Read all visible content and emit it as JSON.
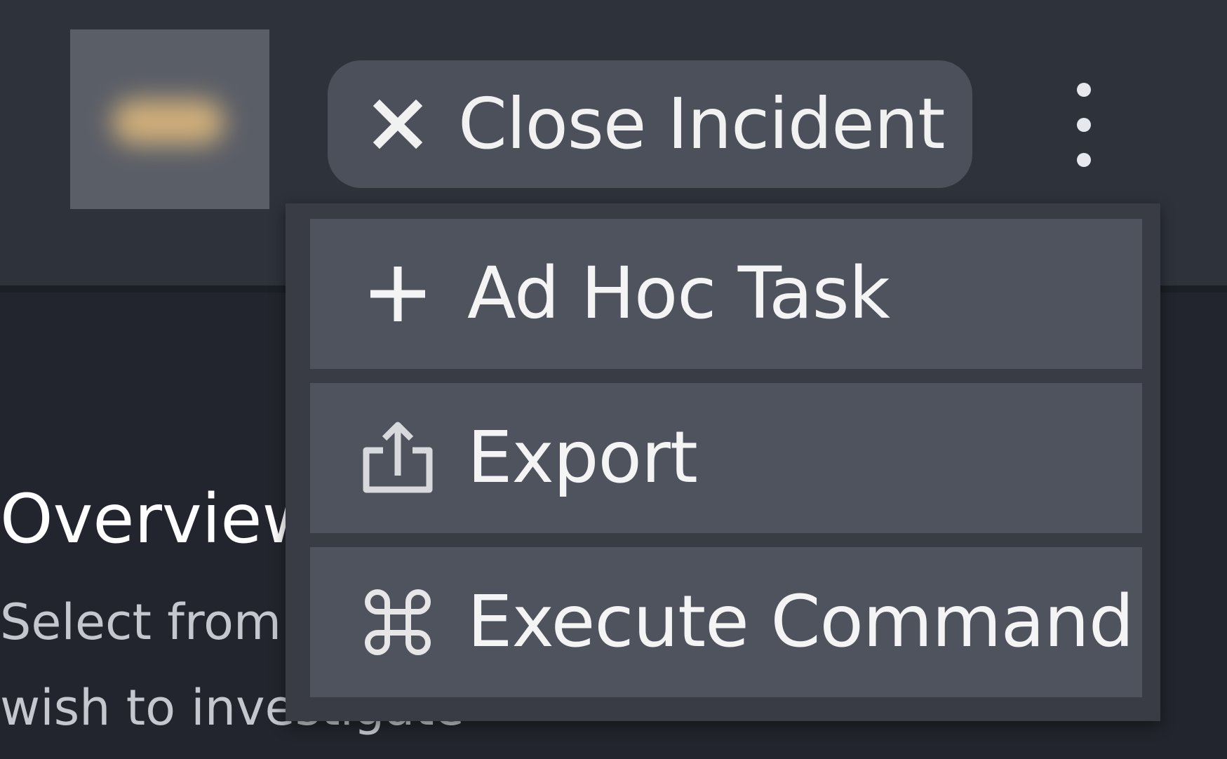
{
  "header": {
    "close_incident_label": "Close Incident",
    "close_icon": "close-icon",
    "more_icon": "kebab-menu-icon"
  },
  "menu": {
    "items": [
      {
        "label": "Ad Hoc Task",
        "icon": "plus-icon"
      },
      {
        "label": "Export",
        "icon": "export-icon"
      },
      {
        "label": "Execute Command",
        "icon": "command-icon"
      }
    ]
  },
  "page": {
    "title": "Overview",
    "subtitle_line1": "Select from",
    "subtitle_line2": "wish to investigate"
  },
  "colors": {
    "background": "#22252d",
    "header": "#2e323b",
    "button": "#4b505a",
    "menu": "#393c44",
    "menu_item": "#4e535e",
    "text": "#f1f1f1"
  }
}
